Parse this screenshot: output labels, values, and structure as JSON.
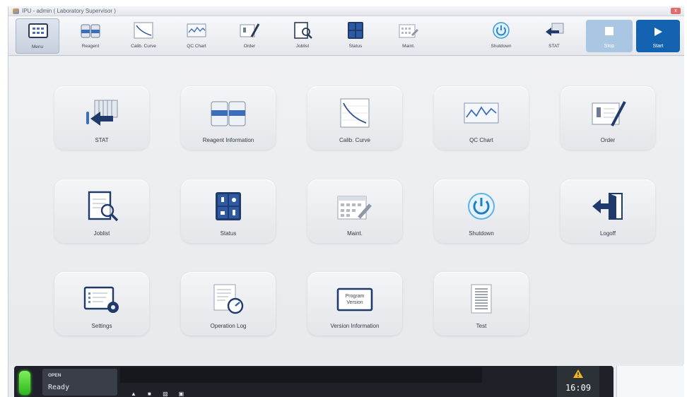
{
  "window": {
    "title": "IPU - admin ( Laboratory Supervisor )",
    "close_label": "x"
  },
  "toolbar": {
    "items": [
      {
        "label": "Menu",
        "icon": "menu-icon",
        "active": true
      },
      {
        "label": "Reagent",
        "icon": "reagent-icon"
      },
      {
        "label": "Calib. Curve",
        "icon": "calib-curve-icon"
      },
      {
        "label": "QC Chart",
        "icon": "qc-chart-icon"
      },
      {
        "label": "Order",
        "icon": "order-icon"
      },
      {
        "label": "Joblist",
        "icon": "joblist-icon"
      },
      {
        "label": "Status",
        "icon": "status-icon"
      },
      {
        "label": "Maint.",
        "icon": "maint-icon"
      },
      {
        "label": "Shutdown",
        "icon": "shutdown-icon"
      },
      {
        "label": "STAT",
        "icon": "stat-icon"
      }
    ],
    "stop_label": "Stop",
    "start_label": "Start"
  },
  "menu": {
    "tiles": [
      {
        "label": "STAT",
        "icon": "stat-icon"
      },
      {
        "label": "Reagent Information",
        "icon": "reagent-icon"
      },
      {
        "label": "Calib. Curve",
        "icon": "calib-curve-icon"
      },
      {
        "label": "QC Chart",
        "icon": "qc-chart-icon"
      },
      {
        "label": "Order",
        "icon": "order-icon"
      },
      {
        "label": "Joblist",
        "icon": "joblist-icon"
      },
      {
        "label": "Status",
        "icon": "status-icon"
      },
      {
        "label": "Maint.",
        "icon": "maint-icon"
      },
      {
        "label": "Shutdown",
        "icon": "shutdown-icon"
      },
      {
        "label": "Logoff",
        "icon": "logoff-icon"
      },
      {
        "label": "Settings",
        "icon": "settings-icon"
      },
      {
        "label": "Operation Log",
        "icon": "operation-log-icon"
      },
      {
        "label": "Version Information",
        "icon": "version-info-icon",
        "icon_text": [
          "Program",
          "Version"
        ]
      },
      {
        "label": "Test",
        "icon": "test-icon"
      }
    ]
  },
  "status": {
    "door": "OPEN",
    "state": "Ready",
    "time": "16:09",
    "led_color": "#3ccc2a",
    "unit_icons": [
      "reagent-unit-icon",
      "sample-unit-icon",
      "rack-unit-icon",
      "printer-unit-icon"
    ]
  },
  "colors": {
    "start": "#1463b0",
    "stop": "#a9c6e2",
    "accent": "#2d5fa8"
  }
}
